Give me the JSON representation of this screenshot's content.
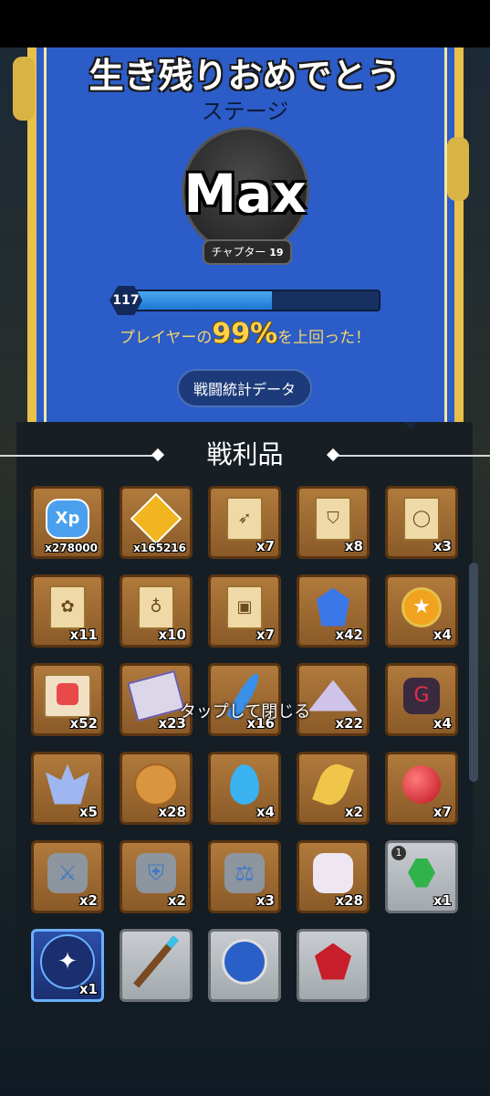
{
  "header": {
    "title": "生き残りおめでとう",
    "stage_label": "ステージ",
    "stage_value": "Max",
    "chapter_label": "チャプター",
    "chapter_number": "19"
  },
  "progress": {
    "level": "117",
    "fill_fraction": 0.57,
    "percent_prefix": "プレイヤーの",
    "percent_value": "99%",
    "percent_suffix": "を上回った！"
  },
  "stats_button": "戦闘統計データ",
  "loot": {
    "title": "戦利品",
    "close_hint": "タップして閉じる",
    "items": [
      {
        "name": "xp",
        "icon": "xp-badge-icon",
        "count": "x278000",
        "style": "brown"
      },
      {
        "name": "bow-token",
        "icon": "bow-diamond-icon",
        "count": "x165216",
        "style": "brown"
      },
      {
        "name": "weapon-scroll",
        "icon": "scroll-bow-icon",
        "count": "x7",
        "style": "brown"
      },
      {
        "name": "armor-scroll",
        "icon": "scroll-armor-icon",
        "count": "x8",
        "style": "brown"
      },
      {
        "name": "ring-scroll",
        "icon": "scroll-ring-icon",
        "count": "x3",
        "style": "brown"
      },
      {
        "name": "pet-scroll",
        "icon": "scroll-paw-icon",
        "count": "x11",
        "style": "brown"
      },
      {
        "name": "necklace-scroll",
        "icon": "scroll-necklace-icon",
        "count": "x10",
        "style": "brown"
      },
      {
        "name": "book-scroll",
        "icon": "scroll-book-icon",
        "count": "x7",
        "style": "brown"
      },
      {
        "name": "blue-gem",
        "icon": "blue-gem-icon",
        "count": "x42",
        "style": "brown"
      },
      {
        "name": "medal",
        "icon": "star-medal-icon",
        "count": "x4",
        "style": "brown"
      },
      {
        "name": "pet-food",
        "icon": "red-paw-scroll-icon",
        "count": "x52",
        "style": "brown"
      },
      {
        "name": "purple-scroll",
        "icon": "purple-scroll-icon",
        "count": "x23",
        "style": "brown"
      },
      {
        "name": "feather",
        "icon": "blue-feather-icon",
        "count": "x16",
        "style": "brown"
      },
      {
        "name": "dust",
        "icon": "dust-pile-icon",
        "count": "x22",
        "style": "brown"
      },
      {
        "name": "dark-rune",
        "icon": "dark-rune-icon",
        "count": "x4",
        "style": "brown"
      },
      {
        "name": "crystal",
        "icon": "crystal-cluster-icon",
        "count": "x5",
        "style": "brown"
      },
      {
        "name": "cookie",
        "icon": "cookie-icon",
        "count": "x28",
        "style": "brown"
      },
      {
        "name": "water-drop",
        "icon": "water-drop-icon",
        "count": "x4",
        "style": "brown"
      },
      {
        "name": "gold-leaf",
        "icon": "gold-leaf-icon",
        "count": "x2",
        "style": "brown"
      },
      {
        "name": "red-orb",
        "icon": "red-orb-icon",
        "count": "x7",
        "style": "brown"
      },
      {
        "name": "sword-stone",
        "icon": "sword-stone-icon",
        "count": "x2",
        "style": "brown"
      },
      {
        "name": "shield-stone",
        "icon": "shield-stone-icon",
        "count": "x2",
        "style": "brown"
      },
      {
        "name": "scale-stone",
        "icon": "scale-stone-icon",
        "count": "x3",
        "style": "brown"
      },
      {
        "name": "white-stone",
        "icon": "white-stone-icon",
        "count": "x28",
        "style": "brown"
      },
      {
        "name": "green-gem",
        "icon": "green-gem-icon",
        "count": "x1",
        "style": "gray",
        "tag": "1"
      },
      {
        "name": "blue-emblem",
        "icon": "blue-emblem-icon",
        "count": "x1",
        "style": "blue"
      },
      {
        "name": "staff",
        "icon": "staff-icon",
        "count": "",
        "style": "gray"
      },
      {
        "name": "eagle-amulet",
        "icon": "eagle-amulet-icon",
        "count": "",
        "style": "gray"
      },
      {
        "name": "red-amulet",
        "icon": "red-amulet-icon",
        "count": "",
        "style": "gray"
      }
    ]
  },
  "colors": {
    "banner_blue": "#2c5cc8",
    "banner_gold": "#e8c04a",
    "xp_fill": "#2a8fe6",
    "highlight_yellow": "#ffd24a",
    "item_brown": "#9a6a32",
    "item_gray": "#b5babf"
  }
}
